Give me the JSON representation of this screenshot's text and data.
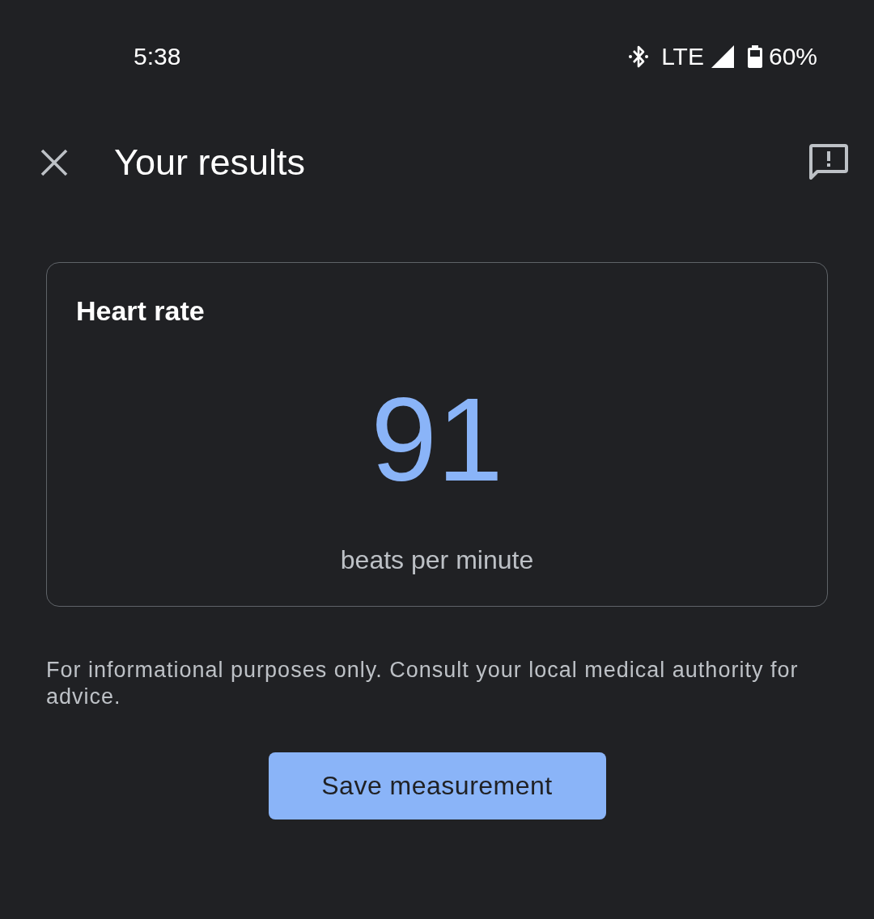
{
  "status_bar": {
    "time": "5:38",
    "network": "LTE",
    "battery": "60%"
  },
  "header": {
    "title": "Your results"
  },
  "card": {
    "title": "Heart rate",
    "value": "91",
    "unit": "beats per minute"
  },
  "disclaimer": "For informational purposes only. Consult your local medical authority for advice.",
  "buttons": [
    {
      "label": "Save measurement",
      "kind": "primary"
    }
  ]
}
